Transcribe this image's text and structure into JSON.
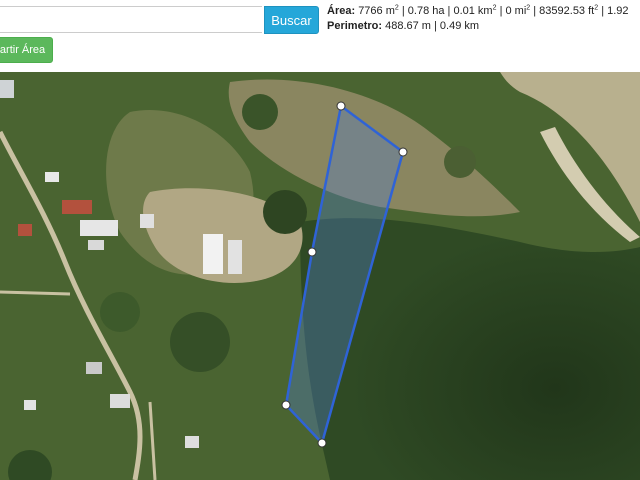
{
  "search": {
    "placeholder": "",
    "value": "",
    "button_label": "Buscar"
  },
  "split_button_label": "partir Área",
  "measurements": {
    "area_label": "Área:",
    "area_m2": "7766 m",
    "sep1": " | ",
    "area_ha": "0.78 ha",
    "sep2": " | ",
    "area_km2": "0.01 km",
    "sep3": " | ",
    "area_mi2": "0 mi",
    "sep4": " | ",
    "area_ft2": "83592.53 ft",
    "sep5": " | 1.92",
    "sq": "2",
    "perimeter_label": "Perimetro:",
    "perimeter_values": "488.67 m | 0.49 km"
  },
  "map": {
    "type": "satellite",
    "polygon_stroke": "#2f63d6",
    "polygon_fill": "#4f7fd0",
    "vertex_color": "#ffffff",
    "vegetation_colors": [
      "#2f4a24",
      "#4d6a33",
      "#8a8660",
      "#c9c1a2"
    ]
  }
}
